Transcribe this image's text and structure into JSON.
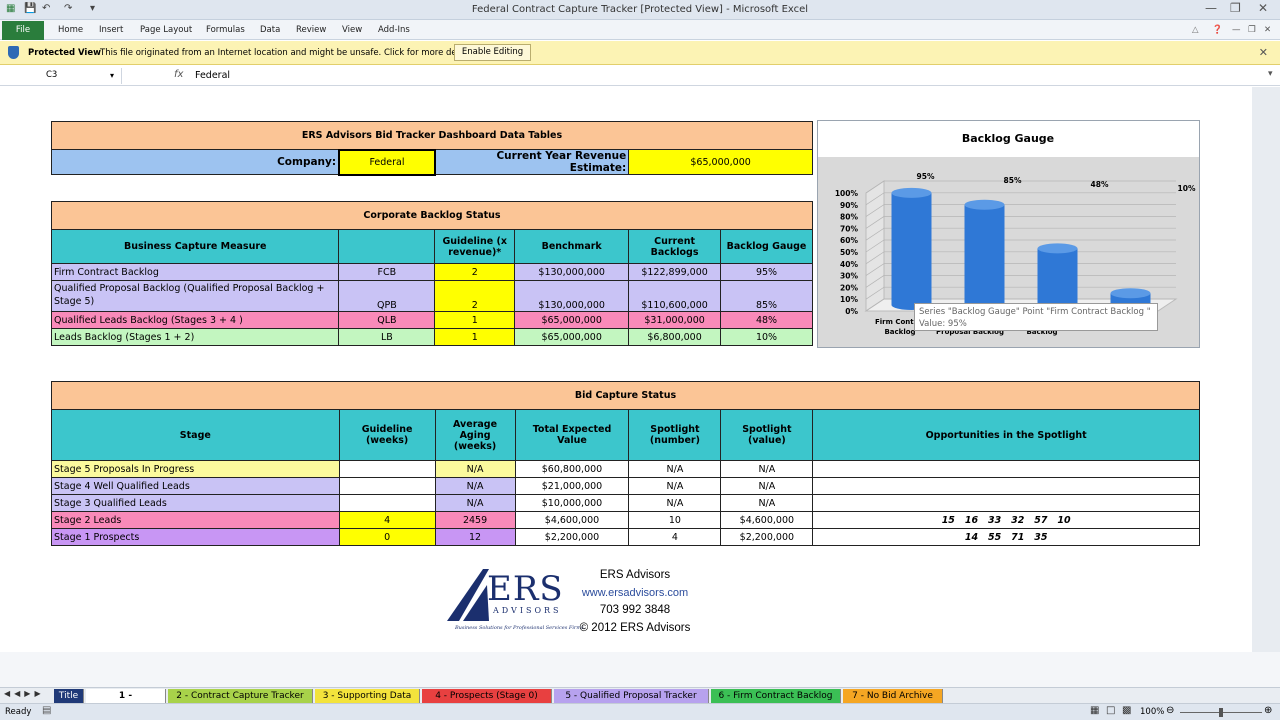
{
  "window": {
    "title": "Federal Contract Capture Tracker  [Protected View]  -  Microsoft Excel"
  },
  "ribbon": {
    "file": "File",
    "tabs": [
      "Home",
      "Insert",
      "Page Layout",
      "Formulas",
      "Data",
      "Review",
      "View",
      "Add-Ins"
    ]
  },
  "protected_view": {
    "label": "Protected View",
    "message": "This file originated from an Internet location and might be unsafe. Click for more details.",
    "button": "Enable Editing"
  },
  "formula_bar": {
    "cell": "C3",
    "fx": "fx",
    "value": "Federal"
  },
  "dashboard": {
    "title": "ERS Advisors Bid Tracker Dashboard Data Tables",
    "company_label": "Company:",
    "company_value": "Federal",
    "revenue_label": "Current Year Revenue Estimate:",
    "revenue_value": "$65,000,000"
  },
  "backlog": {
    "title": "Corporate Backlog Status",
    "headers": [
      "Business Capture Measure",
      "",
      "Guideline (x revenue)*",
      "Benchmark",
      "Current Backlogs",
      "Backlog Gauge"
    ],
    "rows": [
      {
        "measure": "Firm Contract Backlog",
        "code": "FCB",
        "guideline": "2",
        "benchmark": "$130,000,000",
        "current": "$122,899,000",
        "gauge": "95%"
      },
      {
        "measure": "Qualified Proposal Backlog  (Qualified Proposal Backlog + Stage 5)",
        "code": "QPB",
        "guideline": "2",
        "benchmark": "$130,000,000",
        "current": "$110,600,000",
        "gauge": "85%"
      },
      {
        "measure": "Qualified Leads Backlog (Stages 3 + 4 )",
        "code": "QLB",
        "guideline": "1",
        "benchmark": "$65,000,000",
        "current": "$31,000,000",
        "gauge": "48%"
      },
      {
        "measure": "Leads Backlog (Stages 1 + 2)",
        "code": "LB",
        "guideline": "1",
        "benchmark": "$65,000,000",
        "current": "$6,800,000",
        "gauge": "10%"
      }
    ]
  },
  "bid": {
    "title": "Bid Capture  Status",
    "headers": [
      "Stage",
      "Guideline (weeks)",
      "Average Aging (weeks)",
      "Total Expected Value",
      "Spotlight (number)",
      "Spotlight (value)",
      "Opportunities in the Spotlight"
    ],
    "rows": [
      {
        "stage": "Stage 5 Proposals In Progress",
        "guideline": "",
        "aging": "N/A",
        "total": "$60,800,000",
        "num": "N/A",
        "value": "N/A",
        "opps": ""
      },
      {
        "stage": "Stage 4 Well Qualified Leads",
        "guideline": "",
        "aging": "N/A",
        "total": "$21,000,000",
        "num": "N/A",
        "value": "N/A",
        "opps": ""
      },
      {
        "stage": "Stage 3  Qualified Leads",
        "guideline": "",
        "aging": "N/A",
        "total": "$10,000,000",
        "num": "N/A",
        "value": "N/A",
        "opps": ""
      },
      {
        "stage": "Stage 2 Leads",
        "guideline": "4",
        "aging": "2459",
        "total": "$4,600,000",
        "num": "10",
        "value": "$4,600,000",
        "opps": "15   16   33   32   57   10"
      },
      {
        "stage": "Stage 1 Prospects",
        "guideline": "0",
        "aging": "12",
        "total": "$2,200,000",
        "num": "4",
        "value": "$2,200,000",
        "opps": "14   55   71   35"
      }
    ]
  },
  "logo": {
    "mark": "ERS",
    "sub": "ADVISORS",
    "tagline": "Business Solutions for Professional Services Firms",
    "name": "ERS Advisors",
    "url": "www.ersadvisors.com",
    "phone": "703 992 3848",
    "copyright": "© 2012 ERS Advisors"
  },
  "chart_data": {
    "type": "bar",
    "title": "Backlog Gauge",
    "categories": [
      "Firm Contract Backlog",
      "Qualified Proposal Backlog",
      "Qualified Leads Backlog",
      "Leads Backlog"
    ],
    "category_labels_visible": [
      "Firm Contr",
      "Backlog",
      "Proposal Backlog",
      "Backlog"
    ],
    "values": [
      95,
      85,
      48,
      10
    ],
    "data_labels": [
      "95%",
      "85%",
      "48%",
      "10%"
    ],
    "yticks": [
      "100%",
      "90%",
      "80%",
      "70%",
      "60%",
      "50%",
      "40%",
      "30%",
      "20%",
      "10%",
      "0%"
    ],
    "ylim": [
      0,
      100
    ],
    "color": "#2f78d6",
    "tooltip_line1": "Series \"Backlog Gauge\" Point \"Firm Contract Backlog \"",
    "tooltip_line2": "Value: 95%"
  },
  "sheet_tabs": [
    {
      "label": "Title",
      "color": "#203a78",
      "text": "#ffffff"
    },
    {
      "label": "1 - Dashboard",
      "color": "#ffffff",
      "text": "#000000"
    },
    {
      "label": "2 - Contract Capture Tracker",
      "color": "#a8d24a",
      "text": "#000000"
    },
    {
      "label": "3 - Supporting Data",
      "color": "#f3e33c",
      "text": "#000000"
    },
    {
      "label": "4 - Prospects (Stage 0)",
      "color": "#e84040",
      "text": "#000000"
    },
    {
      "label": "5 - Qualified Proposal Tracker",
      "color": "#b7a2ee",
      "text": "#000000"
    },
    {
      "label": "6 - Firm Contract  Backlog",
      "color": "#3bbf55",
      "text": "#000000"
    },
    {
      "label": "7 - No Bid  Archive",
      "color": "#f5a623",
      "text": "#000000"
    }
  ],
  "status": {
    "ready": "Ready",
    "zoom": "100%"
  }
}
